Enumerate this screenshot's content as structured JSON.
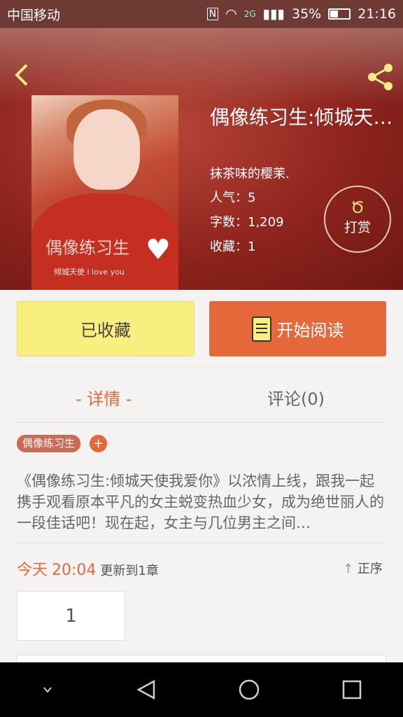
{
  "status": {
    "carrier": "中国移动",
    "network": "2G",
    "battery": "35%",
    "time": "21:16"
  },
  "book": {
    "title": "偶像练习生:倾城天…",
    "author": "抹茶味的樱茉.",
    "popularity": "人气：5",
    "words": "字数：1,209",
    "favorites": "收藏：1",
    "tip_label": "打赏",
    "cover_title": "偶像练习生",
    "cover_subtitle": "倾城天使 i love you"
  },
  "actions": {
    "favorited_label": "已收藏",
    "read_label": "开始阅读"
  },
  "tabs": {
    "details": "- 详情 -",
    "comments": "评论(0)"
  },
  "tags": [
    "偶像练习生"
  ],
  "tag_add": "+",
  "description": "《偶像练习生:倾城天使我爱你》以浓情上线，跟我一起携手观看原本平凡的女主蜕变热血少女，成为绝世丽人的一段佳话吧！现在起，女主与几位男主之间…",
  "update": {
    "day": "今天",
    "time": "20:04",
    "text": "更新到1章",
    "order": "正序"
  },
  "chapters": [
    "1"
  ],
  "colors": {
    "accent": "#e5683a",
    "fav_yellow": "#f9ef81",
    "hero_red": "#9c2a22"
  }
}
